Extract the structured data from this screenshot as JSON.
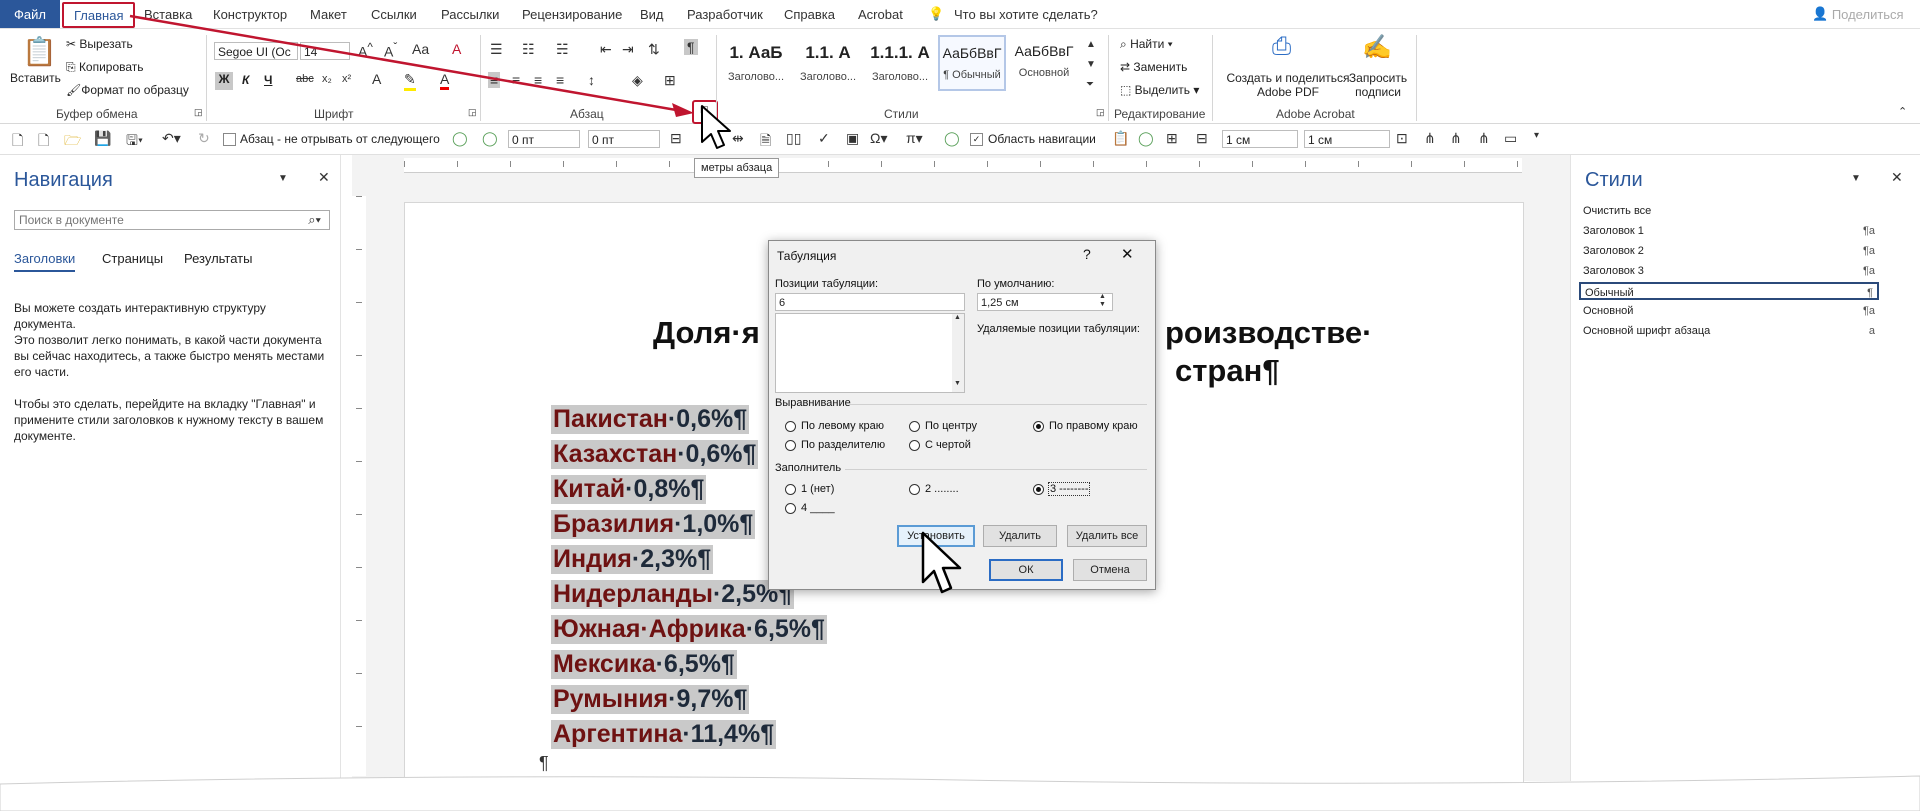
{
  "menubar": {
    "file": "Файл",
    "tabs": [
      "Главная",
      "Вставка",
      "Конструктор",
      "Макет",
      "Ссылки",
      "Рассылки",
      "Рецензирование",
      "Вид",
      "Разработчик",
      "Справка",
      "Acrobat"
    ],
    "tellme": "Что вы хотите сделать?",
    "share": "Поделиться"
  },
  "ribbon": {
    "clipboard": {
      "paste": "Вставить",
      "cut": "Вырезать",
      "copy": "Копировать",
      "format_painter": "Формат по образцу",
      "label": "Буфер обмена"
    },
    "font": {
      "name": "Segoe UI (Ос",
      "size": "14",
      "label": "Шрифт",
      "bold": "Ж",
      "italic": "К",
      "underline": "Ч"
    },
    "paragraph": {
      "label": "Абзац"
    },
    "styles": {
      "label": "Стили",
      "tiles": [
        {
          "big": "1. АаБ",
          "cap": "Заголово..."
        },
        {
          "big": "1.1. А",
          "cap": "Заголово..."
        },
        {
          "big": "1.1.1. А",
          "cap": "Заголово..."
        },
        {
          "big": "АаБбВвГ",
          "cap": "¶ Обычный"
        },
        {
          "big": "АаБбВвГ",
          "cap": "Основной"
        }
      ]
    },
    "editing": {
      "find": "Найти",
      "replace": "Заменить",
      "select": "Выделить",
      "label": "Редактирование"
    },
    "acrobat": {
      "create": "Создать и поделиться",
      "create2": "Adobe PDF",
      "sign": "Запросить",
      "sign2": "подписи",
      "label": "Adobe Acrobat"
    }
  },
  "qat": {
    "keep_with_next": "Абзац - не отрывать от следующего",
    "spacing_before": "0 пт",
    "spacing_after": "0 пт",
    "nav_area": "Область навигации",
    "indent1": "1 см",
    "indent2": "1 см",
    "tooltip": "метры абзаца"
  },
  "nav": {
    "title": "Навигация",
    "search_placeholder": "Поиск в документе",
    "tabs": [
      "Заголовки",
      "Страницы",
      "Результаты"
    ],
    "p1": "Вы можете создать интерактивную структуру документа.",
    "p2": "Это позволит легко понимать, в какой части документа вы сейчас находитесь, а также быстро менять местами его части.",
    "p3": "Чтобы это сделать, перейдите на вкладку \"Главная\" и примените стили заголовков к нужному тексту в вашем документе."
  },
  "styles_pane": {
    "title": "Стили",
    "items": [
      {
        "name": "Очистить все",
        "mark": ""
      },
      {
        "name": "Заголовок 1",
        "mark": "¶a"
      },
      {
        "name": "Заголовок 2",
        "mark": "¶a"
      },
      {
        "name": "Заголовок 3",
        "mark": "¶a"
      },
      {
        "name": "Обычный",
        "mark": "¶"
      },
      {
        "name": "Основной",
        "mark": "¶a"
      },
      {
        "name": "Основной шрифт абзаца",
        "mark": "a"
      }
    ]
  },
  "document": {
    "heading_line1_left": "Доля·я",
    "heading_line1_right": "роизводстве·",
    "heading_line2_right": "стран¶",
    "rows": [
      {
        "country": "Пакистан",
        "pct": "·0,6%¶"
      },
      {
        "country": "Казахстан",
        "pct": "·0,6%¶"
      },
      {
        "country": "Китай",
        "pct": "·0,8%¶"
      },
      {
        "country": "Бразилия",
        "pct": "·1,0%¶"
      },
      {
        "country": "Индия",
        "pct": "·2,3%¶"
      },
      {
        "country": "Нидерланды",
        "pct": "·2,5%¶"
      },
      {
        "country": "Южная·Африка",
        "pct": "·6,5%¶"
      },
      {
        "country": "Мексика",
        "pct": "·6,5%¶"
      },
      {
        "country": "Румыния",
        "pct": "·9,7%¶"
      },
      {
        "country": "Аргентина",
        "pct": "·11,4%¶"
      }
    ],
    "end_mark": "¶"
  },
  "dialog": {
    "title": "Табуляция",
    "help": "?",
    "tab_positions_label": "Позиции табуляции:",
    "tab_positions_value": "6",
    "default_label": "По умолчанию:",
    "default_value": "1,25 см",
    "cleared_label": "Удаляемые позиции табуляции:",
    "alignment_label": "Выравнивание",
    "align_left": "По левому краю",
    "align_center": "По центру",
    "align_right": "По правому краю",
    "align_decimal": "По разделителю",
    "align_bar": "С чертой",
    "leader_label": "Заполнитель",
    "leader1": "1 (нет)",
    "leader2": "2 ........",
    "leader3": "3 --------",
    "leader4": "4 ____",
    "set": "Установить",
    "clear": "Удалить",
    "clear_all": "Удалить все",
    "ok": "ОК",
    "cancel": "Отмена"
  },
  "colors": {
    "word_blue": "#2b579a",
    "highlight_red": "#c0152f",
    "doc_text": "#6e1212",
    "selection": "#c9c9c9"
  }
}
